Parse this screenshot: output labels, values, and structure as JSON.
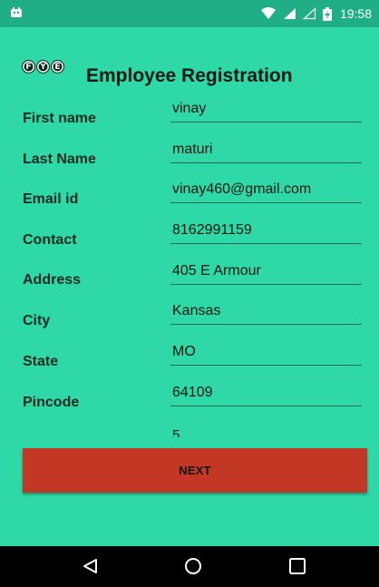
{
  "status_bar": {
    "time": "19:58",
    "icons": [
      "app-notification-icon",
      "wifi-icon",
      "signal-full-icon",
      "signal-empty-icon",
      "battery-charging-icon"
    ]
  },
  "header": {
    "logo_letters": [
      "F",
      "Y",
      "E"
    ],
    "title": "Employee Registration"
  },
  "form": {
    "fields": [
      {
        "label": "First name",
        "value": "vinay"
      },
      {
        "label": "Last Name",
        "value": "maturi"
      },
      {
        "label": "Email id",
        "value": "vinay460@gmail.com"
      },
      {
        "label": "Contact",
        "value": "8162991159"
      },
      {
        "label": "Address",
        "value": "405 E Armour"
      },
      {
        "label": "City",
        "value": "Kansas"
      },
      {
        "label": "State",
        "value": "MO"
      },
      {
        "label": "Pincode",
        "value": "64109"
      }
    ],
    "partial_field_value": "5"
  },
  "buttons": {
    "next_label": "NEXT"
  },
  "navigation": {
    "buttons": [
      "back-icon",
      "home-icon",
      "recents-icon"
    ]
  },
  "colors": {
    "background": "#2fd9a7",
    "status_bar": "#1fae86",
    "next_button": "#c23824",
    "nav_bar": "#000000"
  }
}
